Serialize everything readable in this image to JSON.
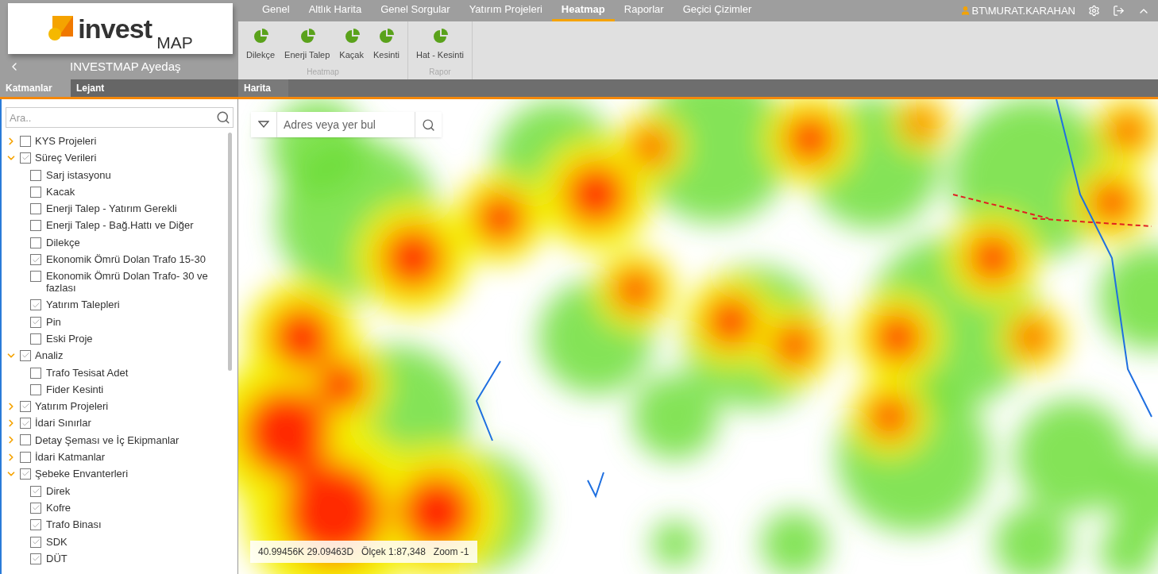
{
  "logo": {
    "word": "invest",
    "suffix": "MAP"
  },
  "nav": [
    {
      "label": "Genel",
      "selected": false
    },
    {
      "label": "Altlık Harita",
      "selected": false
    },
    {
      "label": "Genel Sorgular",
      "selected": false
    },
    {
      "label": "Yatırım Projeleri",
      "selected": false
    },
    {
      "label": "Heatmap",
      "selected": true
    },
    {
      "label": "Raporlar",
      "selected": false
    },
    {
      "label": "Geçici Çizimler",
      "selected": false
    }
  ],
  "user": "BT\\MURAT.KARAHAN",
  "app_title": "INVESTMAP Ayedaş",
  "ribbon": [
    {
      "name": "Heatmap",
      "buttons": [
        "Dilekçe",
        "Enerji Talep",
        "Kaçak",
        "Kesinti"
      ]
    },
    {
      "name": "Rapor",
      "buttons": [
        "Hat - Kesinti"
      ]
    }
  ],
  "panel_tabs": [
    {
      "label": "Katmanlar",
      "selected": true
    },
    {
      "label": "Lejant",
      "selected": false
    }
  ],
  "map_tab": "Harita",
  "layer_search": {
    "placeholder": "Ara.."
  },
  "layers": [
    {
      "label": "KYS Projeleri",
      "checked": false,
      "expanded": false
    },
    {
      "label": "Süreç Verileri",
      "checked": true,
      "expanded": true,
      "children": [
        {
          "label": "Sarj istasyonu",
          "checked": false
        },
        {
          "label": "Kacak",
          "checked": false
        },
        {
          "label": "Enerji Talep - Yatırım Gerekli",
          "checked": false
        },
        {
          "label": "Enerji Talep - Bağ.Hattı ve Diğer",
          "checked": false
        },
        {
          "label": "Dilekçe",
          "checked": false
        },
        {
          "label": "Ekonomik Ömrü Dolan Trafo 15-30",
          "checked": true
        },
        {
          "label": "Ekonomik Ömrü Dolan Trafo- 30 ve fazlası",
          "checked": false
        },
        {
          "label": "Yatırım Talepleri",
          "checked": true
        },
        {
          "label": "Pin",
          "checked": true
        },
        {
          "label": "Eski Proje",
          "checked": false
        }
      ]
    },
    {
      "label": "Analiz",
      "checked": true,
      "expanded": true,
      "children": [
        {
          "label": "Trafo Tesisat Adet",
          "checked": false
        },
        {
          "label": "Fider Kesinti",
          "checked": false
        }
      ]
    },
    {
      "label": "Yatırım Projeleri",
      "checked": true,
      "expanded": false
    },
    {
      "label": "İdari Sınırlar",
      "checked": true,
      "expanded": false
    },
    {
      "label": "Detay Şeması ve İç Ekipmanlar",
      "checked": false,
      "expanded": false
    },
    {
      "label": "İdari Katmanlar",
      "checked": false,
      "expanded": false
    },
    {
      "label": "Şebeke Envanterleri",
      "checked": true,
      "expanded": true,
      "children": [
        {
          "label": "Direk",
          "checked": true
        },
        {
          "label": "Kofre",
          "checked": true
        },
        {
          "label": "Trafo Binası",
          "checked": true
        },
        {
          "label": "SDK",
          "checked": true
        },
        {
          "label": "DÜT",
          "checked": true
        }
      ]
    }
  ],
  "map_search": {
    "placeholder": "Adres veya yer bul"
  },
  "status": {
    "coordinates": "40.99456K 29.09463D",
    "scale": "Ölçek 1:87,348",
    "zoom": "Zoom -1"
  }
}
